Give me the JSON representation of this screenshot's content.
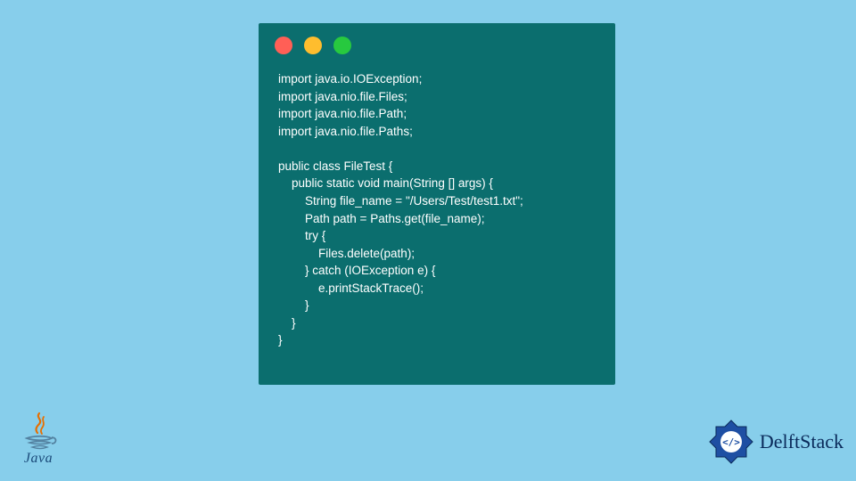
{
  "code_window": {
    "lines": [
      "import java.io.IOException;",
      "import java.nio.file.Files;",
      "import java.nio.file.Path;",
      "import java.nio.file.Paths;",
      "",
      "public class FileTest {",
      "    public static void main(String [] args) {",
      "        String file_name = \"/Users/Test/test1.txt\";",
      "        Path path = Paths.get(file_name);",
      "        try {",
      "            Files.delete(path);",
      "        } catch (IOException e) {",
      "            e.printStackTrace();",
      "        }",
      "    }",
      "}"
    ],
    "colors": {
      "background": "#0b6e6e",
      "text": "#ffffff",
      "red": "#ff5f56",
      "yellow": "#ffbd2e",
      "green": "#27c93f"
    }
  },
  "logos": {
    "java_label": "Java",
    "delftstack_label": "DelftStack"
  },
  "page": {
    "background": "#87ceeb"
  }
}
